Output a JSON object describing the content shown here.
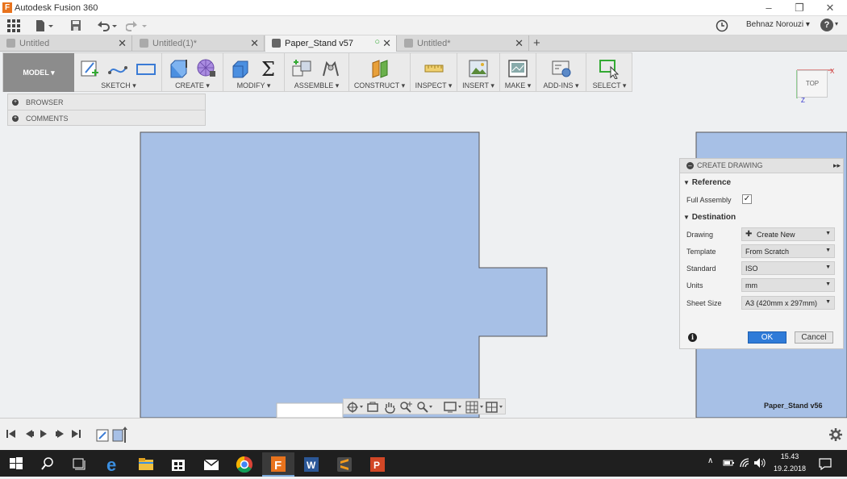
{
  "window": {
    "title": "Autodesk Fusion 360",
    "logo_letter": "F"
  },
  "appbar": {
    "user": "Behnaz Norouzi ▾",
    "help": "?"
  },
  "tabs": [
    {
      "label": "Untitled",
      "active": false
    },
    {
      "label": "Untitled(1)*",
      "active": false
    },
    {
      "label": "Paper_Stand v57",
      "active": true
    },
    {
      "label": "Untitled*",
      "active": false
    }
  ],
  "toolbar": {
    "model_label": "MODEL ▾",
    "groups": [
      {
        "label": "SKETCH ▾"
      },
      {
        "label": "CREATE ▾"
      },
      {
        "label": "MODIFY ▾"
      },
      {
        "label": "ASSEMBLE ▾"
      },
      {
        "label": "CONSTRUCT ▾"
      },
      {
        "label": "INSPECT ▾"
      },
      {
        "label": "INSERT ▾"
      },
      {
        "label": "MAKE ▾"
      },
      {
        "label": "ADD-INS ▾"
      },
      {
        "label": "SELECT ▾"
      }
    ]
  },
  "browser": {
    "browser_label": "BROWSER",
    "comments_label": "COMMENTS"
  },
  "viewcube": {
    "face": "TOP"
  },
  "create_drawing": {
    "title": "CREATE DRAWING",
    "reference_label": "Reference",
    "full_assembly_label": "Full Assembly",
    "full_assembly_checked": true,
    "destination_label": "Destination",
    "fields": [
      {
        "label": "Drawing",
        "value": "Create New"
      },
      {
        "label": "Template",
        "value": "From Scratch"
      },
      {
        "label": "Standard",
        "value": "ISO"
      },
      {
        "label": "Units",
        "value": "mm"
      },
      {
        "label": "Sheet Size",
        "value": "A3 (420mm x 297mm)"
      }
    ],
    "ok_label": "OK",
    "cancel_label": "Cancel"
  },
  "viewport": {
    "secondary_label": "Paper_Stand v56",
    "body_color": "#a7c0e6"
  },
  "taskbar": {
    "time": "15.43",
    "date": "19.2.2018"
  }
}
